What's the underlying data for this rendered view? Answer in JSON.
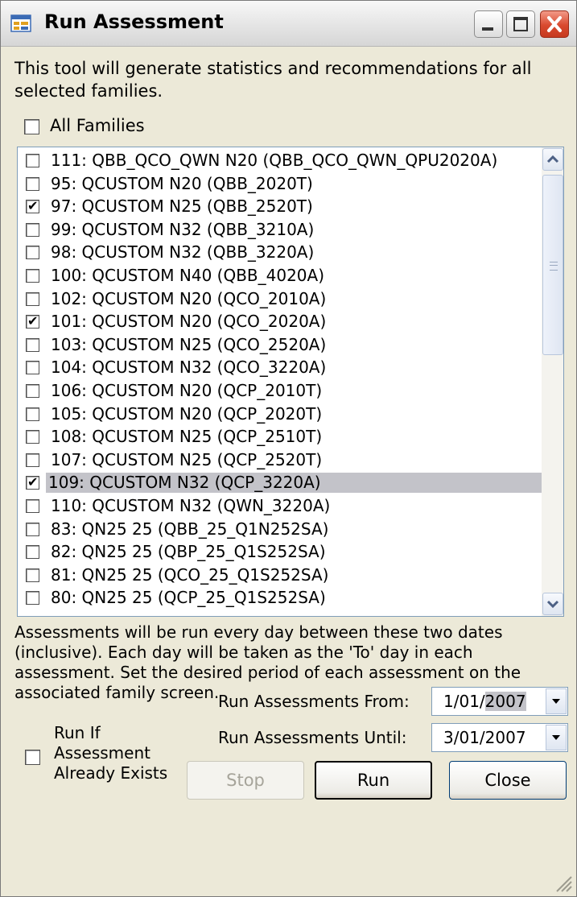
{
  "window": {
    "title": "Run Assessment",
    "app_icon": "form-icon",
    "controls": [
      "minimize-icon",
      "maximize-icon",
      "close-icon"
    ]
  },
  "intro_text": "This tool will generate statistics and recommendations for all selected families.",
  "all_families": {
    "label": "All Families",
    "checked": false
  },
  "families": [
    {
      "label": "111: QBB_QCO_QWN N20 (QBB_QCO_QWN_QPU2020A)",
      "checked": false,
      "selected": false
    },
    {
      "label": "95: QCUSTOM N20 (QBB_2020T)",
      "checked": false,
      "selected": false
    },
    {
      "label": "97: QCUSTOM N25 (QBB_2520T)",
      "checked": true,
      "selected": false
    },
    {
      "label": "99: QCUSTOM N32 (QBB_3210A)",
      "checked": false,
      "selected": false
    },
    {
      "label": "98: QCUSTOM N32 (QBB_3220A)",
      "checked": false,
      "selected": false
    },
    {
      "label": "100: QCUSTOM N40 (QBB_4020A)",
      "checked": false,
      "selected": false
    },
    {
      "label": "102: QCUSTOM N20 (QCO_2010A)",
      "checked": false,
      "selected": false
    },
    {
      "label": "101: QCUSTOM N20 (QCO_2020A)",
      "checked": true,
      "selected": false
    },
    {
      "label": "103: QCUSTOM N25 (QCO_2520A)",
      "checked": false,
      "selected": false
    },
    {
      "label": "104: QCUSTOM N32 (QCO_3220A)",
      "checked": false,
      "selected": false
    },
    {
      "label": "106: QCUSTOM N20 (QCP_2010T)",
      "checked": false,
      "selected": false
    },
    {
      "label": "105: QCUSTOM N20 (QCP_2020T)",
      "checked": false,
      "selected": false
    },
    {
      "label": "108: QCUSTOM N25 (QCP_2510T)",
      "checked": false,
      "selected": false
    },
    {
      "label": "107: QCUSTOM N25 (QCP_2520T)",
      "checked": false,
      "selected": false
    },
    {
      "label": "109: QCUSTOM N32 (QCP_3220A)",
      "checked": true,
      "selected": true
    },
    {
      "label": "110: QCUSTOM N32 (QWN_3220A)",
      "checked": false,
      "selected": false
    },
    {
      "label": "83: QN25 25 (QBB_25_Q1N252SA)",
      "checked": false,
      "selected": false
    },
    {
      "label": "82: QN25 25 (QBP_25_Q1S252SA)",
      "checked": false,
      "selected": false
    },
    {
      "label": "81: QN25 25 (QCO_25_Q1S252SA)",
      "checked": false,
      "selected": false
    },
    {
      "label": "80: QN25 25 (QCP_25_Q1S252SA)",
      "checked": false,
      "selected": false
    }
  ],
  "info_text": "Assessments will be run every day between these two dates (inclusive). Each day will be taken as the 'To' day in each assessment. Set the desired period of each assessment on the associated family screen.",
  "run_if_exists": {
    "label_lines": [
      "Run If",
      "Assessment",
      "Already Exists"
    ],
    "checked": false
  },
  "date_from": {
    "label": "Run Assessments From:",
    "prefix": "1/01/",
    "highlight": "2007"
  },
  "date_until": {
    "label": "Run Assessments Until:",
    "value": "3/01/2007"
  },
  "buttons": {
    "stop": "Stop",
    "run": "Run",
    "close": "Close"
  }
}
